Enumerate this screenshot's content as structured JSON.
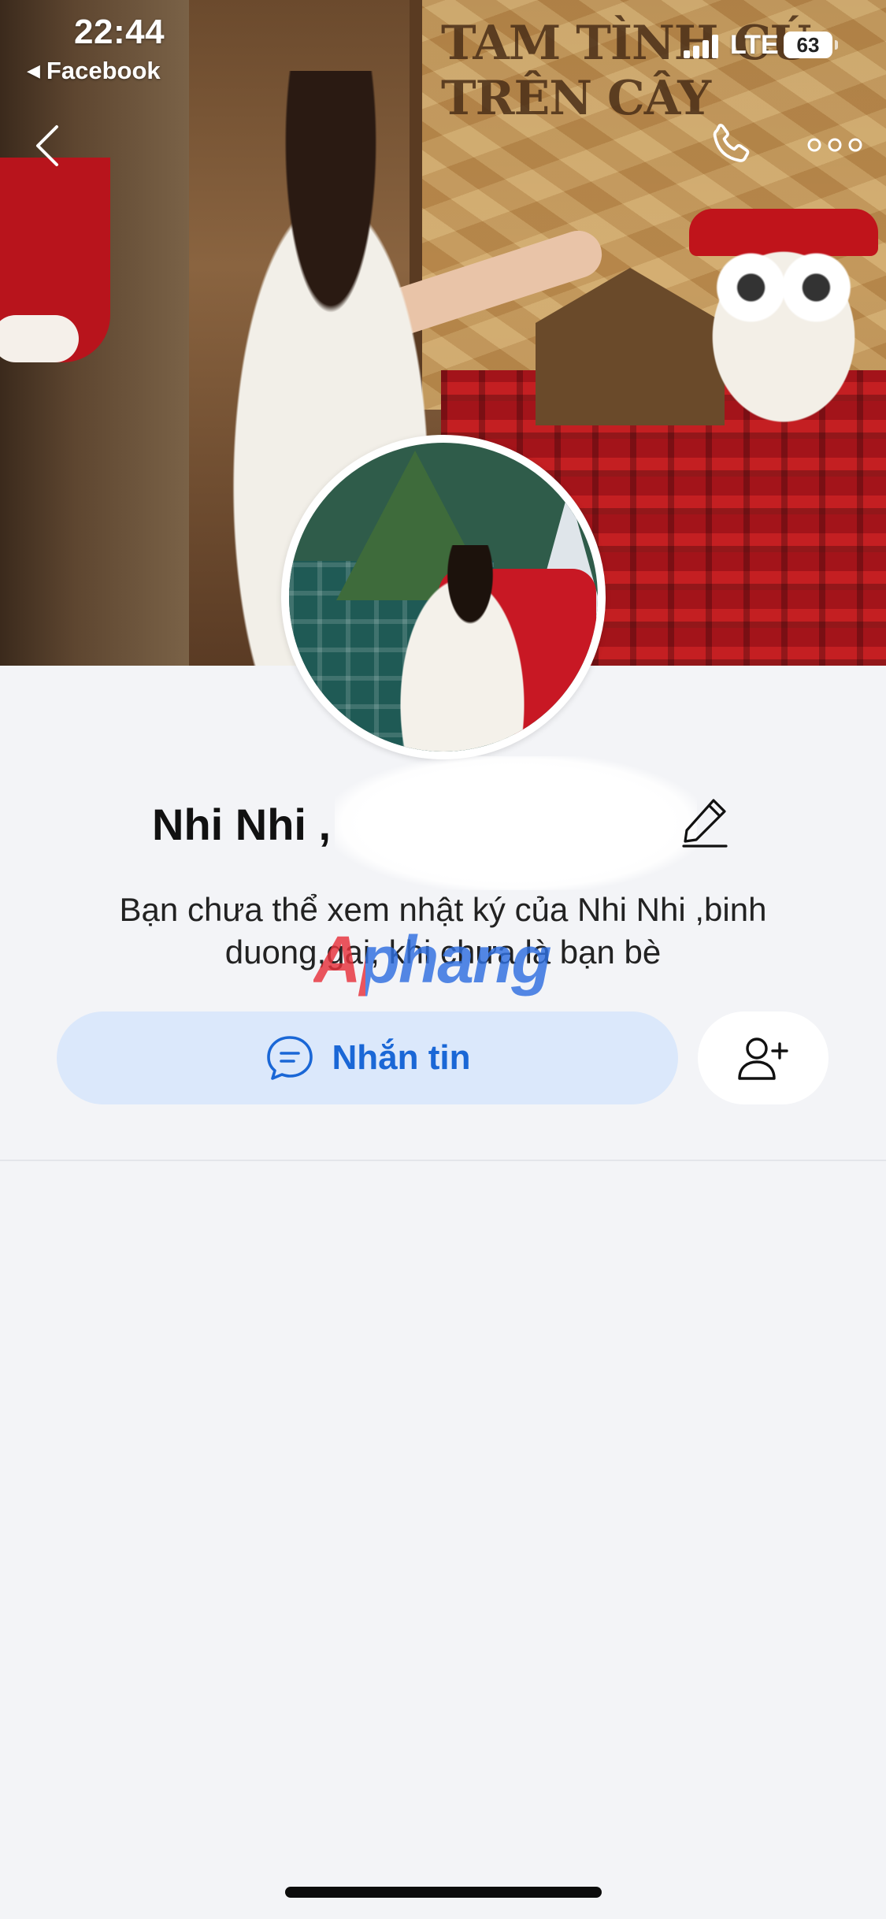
{
  "status_bar": {
    "time": "22:44",
    "back_app": "Facebook",
    "carrier": "LTE",
    "battery": "63"
  },
  "cover": {
    "sign_text": "TAM TÌNH CÚ TRÊN CÂY"
  },
  "nav": {
    "back_icon": "chevron-left-icon",
    "call_icon": "phone-icon",
    "more_icon": "more-dots-icon"
  },
  "profile": {
    "name": "Nhi Nhi ,",
    "edit_icon": "pencil-icon",
    "privacy_message": "Bạn chưa thể xem nhật ký của Nhi Nhi ,binh duong,gai, khi chưa là bạn bè"
  },
  "watermark": "Aphang",
  "actions": {
    "message_label": "Nhắn tin",
    "message_icon": "chat-bubble-icon",
    "add_friend_icon": "add-friend-icon"
  },
  "colors": {
    "accent": "#1a67d6",
    "button_bg": "#dbe8fb",
    "page_bg": "#f3f4f7"
  }
}
